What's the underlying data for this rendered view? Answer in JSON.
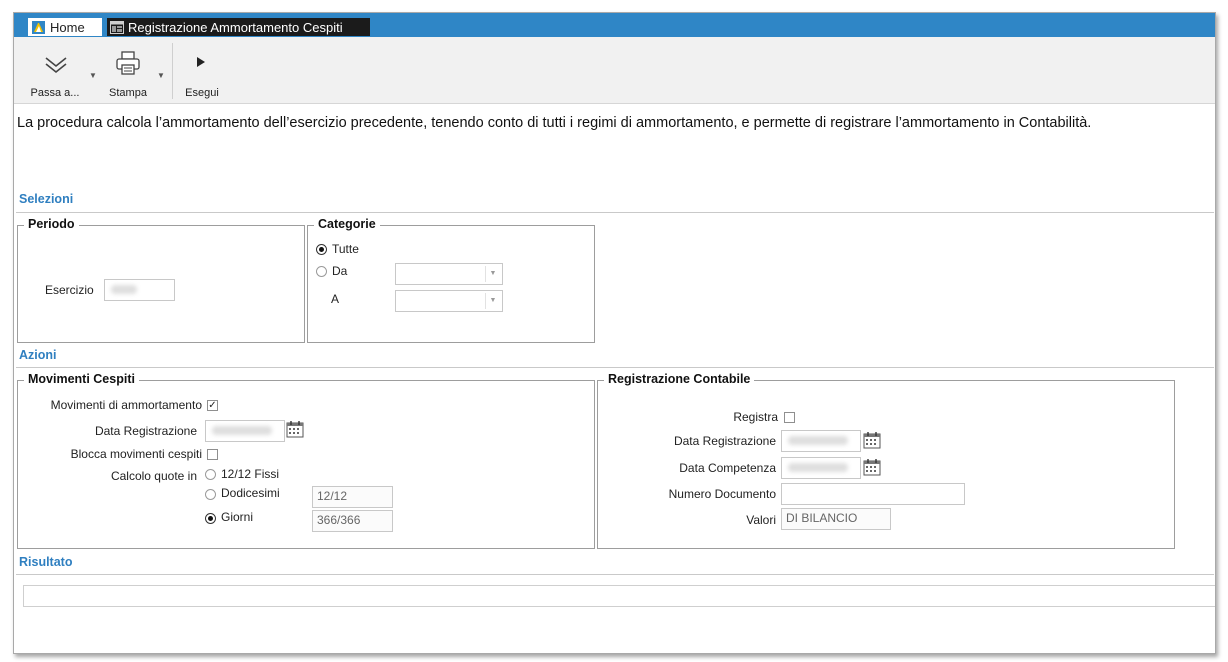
{
  "tabs": {
    "home": "Home",
    "active": "Registrazione Ammortamento Cespiti"
  },
  "toolbar": {
    "passa": "Passa a...",
    "stampa": "Stampa",
    "esegui": "Esegui"
  },
  "description": "La procedura calcola l’ammortamento dell’esercizio precedente, tenendo conto di tutti i regimi di ammortamento, e permette di registrare l’ammortamento in Contabilità.",
  "sections": {
    "selezioni": "Selezioni",
    "azioni": "Azioni",
    "risultato": "Risultato"
  },
  "periodo": {
    "legend": "Periodo",
    "esercizio_label": "Esercizio"
  },
  "categorie": {
    "legend": "Categorie",
    "tutte": "Tutte",
    "da": "Da",
    "a": "A",
    "selected": "Tutte"
  },
  "movimenti": {
    "legend": "Movimenti Cespiti",
    "movimenti_ammortamento": "Movimenti di ammortamento",
    "movimenti_ammortamento_checked": true,
    "data_registrazione": "Data Registrazione",
    "blocca": "Blocca movimenti cespiti",
    "blocca_checked": false,
    "calcolo": "Calcolo quote in",
    "options": [
      "12/12 Fissi",
      "Dodicesimi",
      "Giorni"
    ],
    "selected_option": "Giorni",
    "dodicesimi_value": "12/12",
    "giorni_value": "366/366"
  },
  "registrazione": {
    "legend": "Registrazione Contabile",
    "registra": "Registra",
    "registra_checked": false,
    "data_registrazione": "Data Registrazione",
    "data_competenza": "Data Competenza",
    "numero_documento": "Numero Documento",
    "numero_documento_value": "",
    "valori": "Valori",
    "valori_value": "DI BILANCIO"
  },
  "colors": {
    "titlebar": "#2f86c6",
    "section": "#2f7fc0"
  }
}
